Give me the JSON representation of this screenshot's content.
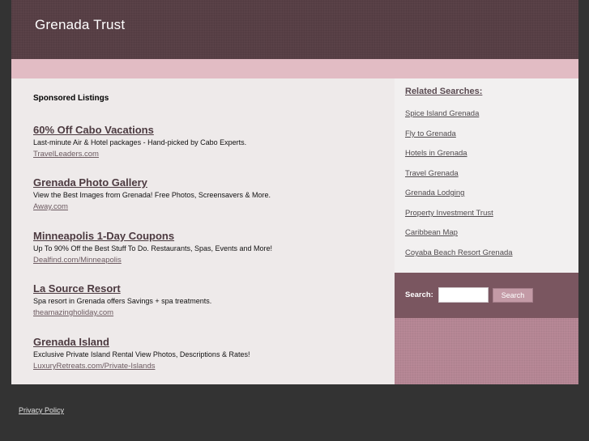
{
  "header": {
    "title": "Grenada Trust"
  },
  "main": {
    "sponsored_heading": "Sponsored Listings",
    "listings": [
      {
        "title": "60% Off Cabo Vacations",
        "description": "Last-minute Air & Hotel packages - Hand-picked by Cabo Experts.",
        "url": "TravelLeaders.com"
      },
      {
        "title": "Grenada Photo Gallery",
        "description": "View the Best Images from Grenada! Free Photos, Screensavers & More.",
        "url": "Away.com"
      },
      {
        "title": "Minneapolis 1-Day Coupons",
        "description": "Up To 90% Off the Best Stuff To Do. Restaurants, Spas, Events and More!",
        "url": "Dealfind.com/Minneapolis"
      },
      {
        "title": "La Source Resort",
        "description": "Spa resort in Grenada offers Savings + spa treatments.",
        "url": "theamazingholiday.com"
      },
      {
        "title": "Grenada Island",
        "description": "Exclusive Private Island Rental View Photos, Descriptions & Rates!",
        "url": "LuxuryRetreats.com/Private-Islands"
      }
    ]
  },
  "sidebar": {
    "related_heading": "Related Searches:",
    "related_links": [
      "Spice Island Grenada",
      "Fly to Grenada",
      "Hotels in Grenada",
      "Travel Grenada",
      "Grenada Lodging",
      "Property Investment Trust",
      "Caribbean Map",
      "Coyaba Beach Resort Grenada"
    ],
    "search": {
      "label": "Search:",
      "input_value": "",
      "button_label": "Search"
    }
  },
  "footer": {
    "privacy_label": "Privacy Policy"
  },
  "colors": {
    "header_bg": "#5a4248",
    "pink_band": "#e2bcc4",
    "main_bg": "#eeeaea",
    "sidebar_bg": "#f2f0f0",
    "search_bg": "#7a5660",
    "accent_pink": "#b78896",
    "page_bg": "#333333"
  }
}
